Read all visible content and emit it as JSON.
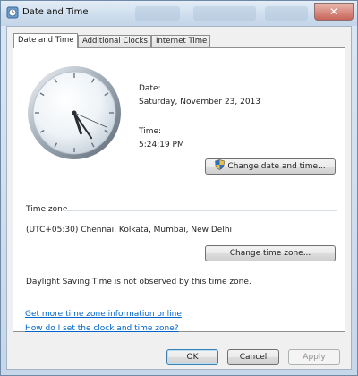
{
  "window": {
    "title": "Date and Time",
    "close_glyph": "✕"
  },
  "tabs": [
    {
      "label": "Date and Time"
    },
    {
      "label": "Additional Clocks"
    },
    {
      "label": "Internet Time"
    }
  ],
  "clock": {
    "hour": 5,
    "minute": 24,
    "second": 19
  },
  "date": {
    "label": "Date:",
    "value": "Saturday, November 23, 2013"
  },
  "time": {
    "label": "Time:",
    "value": "5:24:19 PM"
  },
  "buttons": {
    "change_date_time": "Change date and time...",
    "change_time_zone": "Change time zone..."
  },
  "time_zone": {
    "group_label": "Time zone",
    "value": "(UTC+05:30) Chennai, Kolkata, Mumbai, New Delhi",
    "dst_note": "Daylight Saving Time is not observed by this time zone."
  },
  "links": {
    "more_info": "Get more time zone information online",
    "how_to_set": "How do I set the clock and time zone?"
  },
  "footer": {
    "ok": "OK",
    "cancel": "Cancel",
    "apply": "Apply"
  },
  "icons": {
    "window": "clock-icon",
    "uac": "uac-shield-icon"
  }
}
